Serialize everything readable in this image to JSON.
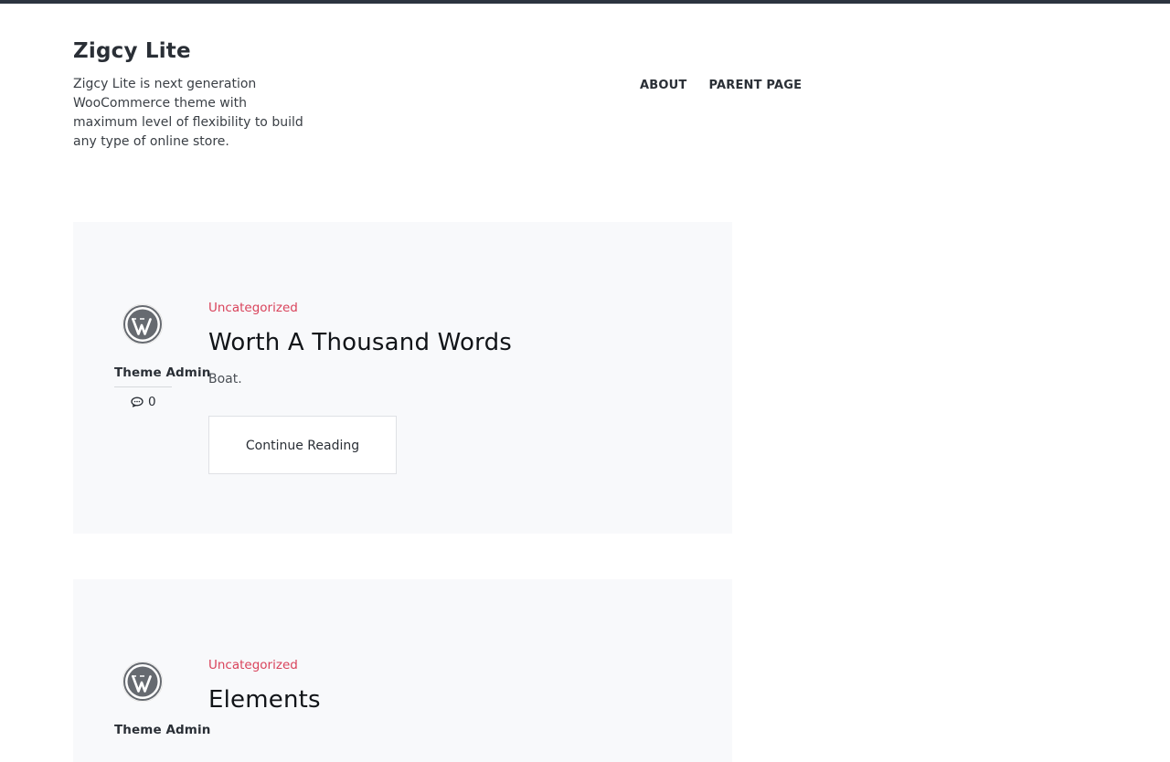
{
  "site": {
    "title": "Zigcy Lite",
    "description": "Zigcy Lite is next generation WooCommerce theme with maximum level of flexibility to build any type of online store."
  },
  "nav": {
    "items": [
      {
        "label": "ABOUT"
      },
      {
        "label": "PARENT PAGE"
      }
    ]
  },
  "posts": [
    {
      "category": "Uncategorized",
      "title": "Worth A Thousand Words",
      "excerpt": "Boat.",
      "author": "Theme Admin",
      "comments": "0",
      "cta": "Continue Reading",
      "avatar_icon": "wordpress-logo-icon"
    },
    {
      "category": "Uncategorized",
      "title": "Elements",
      "author": "Theme Admin",
      "avatar_icon": "wordpress-logo-icon"
    }
  ],
  "colors": {
    "accent": "#d9435b",
    "topbar": "#2c3440",
    "card_bg": "#f8f9fb"
  }
}
